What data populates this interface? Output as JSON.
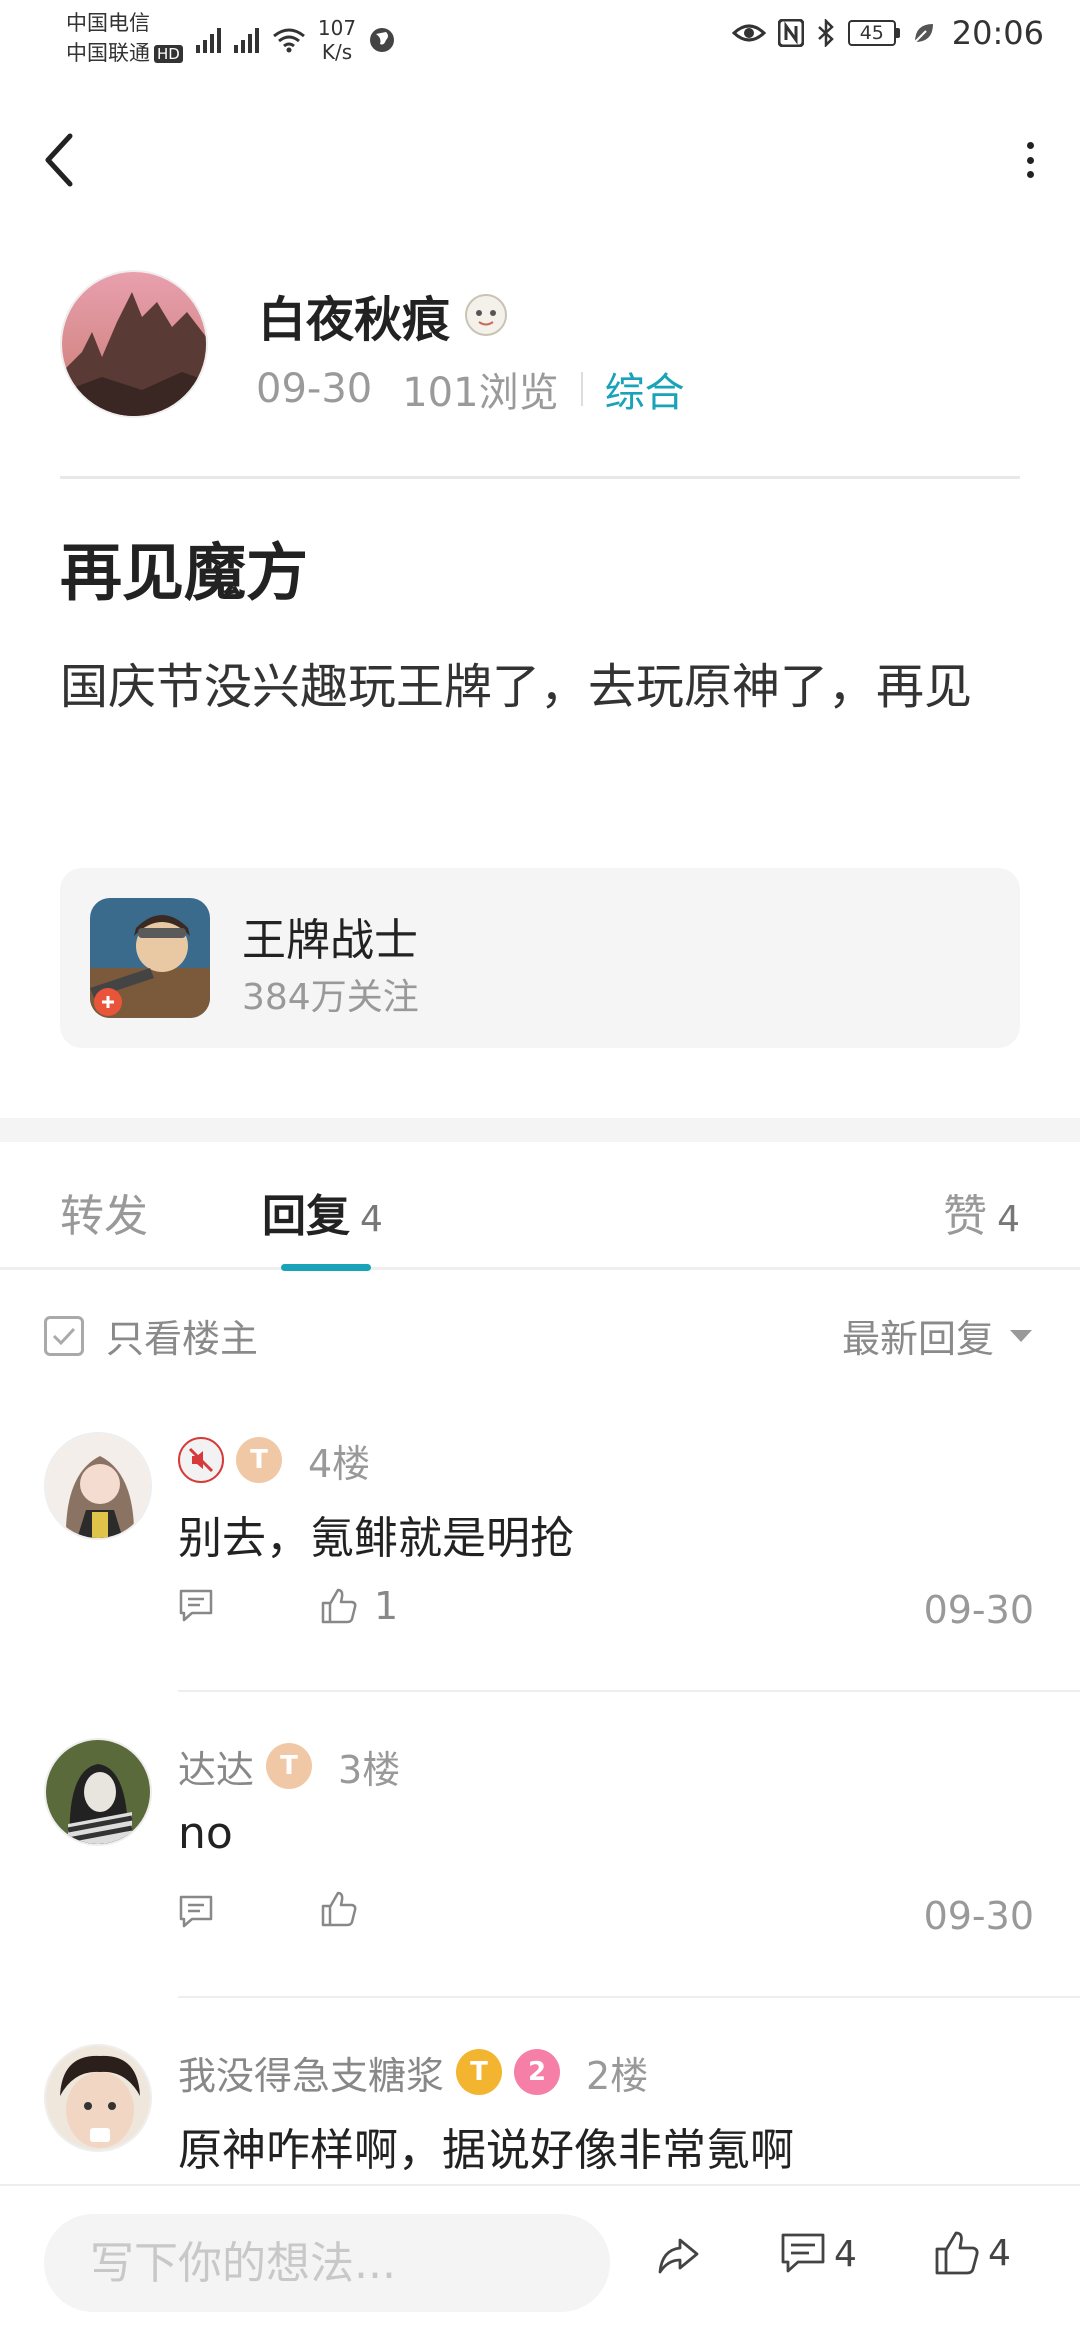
{
  "status_bar": {
    "carrier_1": "中国电信",
    "carrier_2": "中国联通",
    "hd_badge": "HD",
    "signal_1_label": "2G",
    "signal_2_label": "4G",
    "net_speed_value": "107",
    "net_speed_unit": "K/s",
    "battery": "45",
    "time": "20:06"
  },
  "post": {
    "author": {
      "name": "白夜秋痕",
      "date": "09-30",
      "views": "101浏览",
      "category": "综合"
    },
    "title": "再见魔方",
    "body": "国庆节没兴趣玩王牌了，去玩原神了，再见",
    "game_card": {
      "name": "王牌战士",
      "followers": "384万关注"
    }
  },
  "tabs": {
    "forward": {
      "label": "转发"
    },
    "reply": {
      "label": "回复",
      "count": "4"
    },
    "like": {
      "label": "赞",
      "count": "4"
    }
  },
  "filter": {
    "only_author": "只看楼主",
    "sort": "最新回复"
  },
  "replies": [
    {
      "username": "",
      "floor": "4楼",
      "text": "别去，氪鲱就是明抢",
      "likes": "1",
      "date": "09-30"
    },
    {
      "username": "达达",
      "floor": "3楼",
      "text": "no",
      "likes": "",
      "date": "09-30"
    },
    {
      "username": "我没得急支糖浆",
      "floor": "2楼",
      "text": "原神咋样啊，据说好像非常氪啊",
      "likes": "",
      "date": ""
    }
  ],
  "bottom_bar": {
    "input_placeholder": "写下你的想法...",
    "comment_count": "4",
    "like_count": "4"
  },
  "colors": {
    "accent": "#19a3b8",
    "text_primary": "#222222",
    "text_secondary": "#999999"
  },
  "icons": [
    "back-icon",
    "more-icon",
    "checkbox-icon",
    "caret-down-icon",
    "comment-icon",
    "thumb-up-icon",
    "share-icon"
  ]
}
